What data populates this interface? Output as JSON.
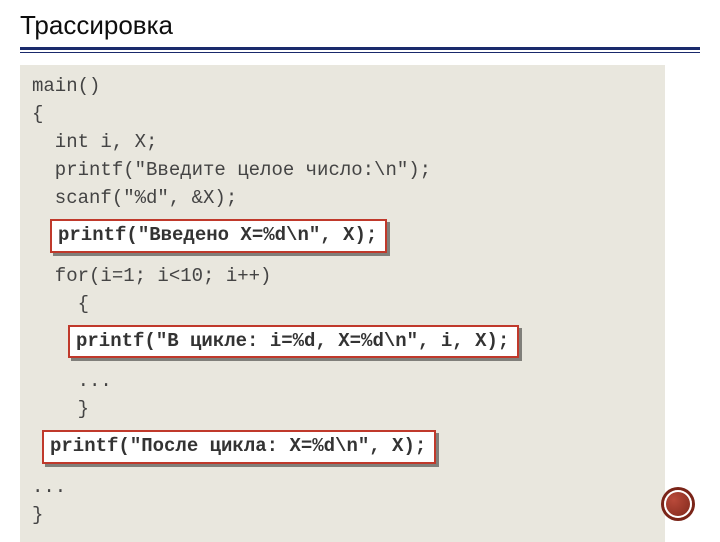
{
  "title": "Трассировка",
  "code": {
    "l1": "main()",
    "l2": "{",
    "l3": "  int i, X;",
    "l4": "  printf(\"Введите целое число:\\n\");",
    "l5": "  scanf(\"%d\", &X);",
    "hl1": "printf(\"Введено X=%d\\n\", X);",
    "l6": "  for(i=1; i<10; i++)",
    "l7": "    {",
    "hl2": "printf(\"В цикле: i=%d, X=%d\\n\", i, X);",
    "l8": "    ...",
    "l9": "    }",
    "hl3": "printf(\"После цикла: X=%d\\n\", X);",
    "l10": "...",
    "l11": "}"
  }
}
